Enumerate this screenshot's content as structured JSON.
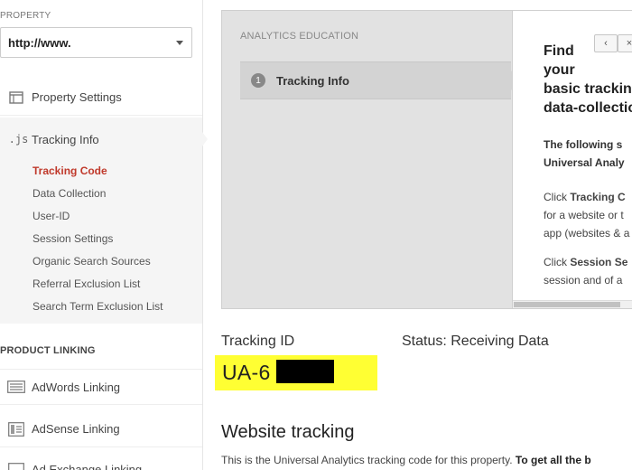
{
  "sidebar": {
    "property_label": "PROPERTY",
    "property_value": "http://www.",
    "items": {
      "property_settings": "Property Settings",
      "tracking_info": "Tracking Info"
    },
    "tracking_subitems": [
      "Tracking Code",
      "Data Collection",
      "User-ID",
      "Session Settings",
      "Organic Search Sources",
      "Referral Exclusion List",
      "Search Term Exclusion List"
    ],
    "js_icon_text": ".js",
    "product_linking_label": "PRODUCT LINKING",
    "linking_items": {
      "adwords": "AdWords Linking",
      "adsense": "AdSense Linking",
      "adexchange": "Ad Exchange Linking"
    }
  },
  "education": {
    "title": "ANALYTICS EDUCATION",
    "step_number": "1",
    "step_label": "Tracking Info",
    "nav_prev": "‹",
    "nav_next": "×",
    "heading": "Find\nyour\nbasic tracking\ndata-collection",
    "p1": "The following s\nUniversal Analy",
    "p2_prefix": "Click ",
    "p2_bold": "Tracking C",
    "p2_rest": "\nfor a website or t\napp (websites & a",
    "p3_prefix": "Click ",
    "p3_bold": "Session Se",
    "p3_rest": "\nsession and of a"
  },
  "tracking": {
    "id_label": "Tracking ID",
    "status": "Status: Receiving Data",
    "id_value": "UA-6         3-5"
  },
  "website_tracking": {
    "heading": "Website tracking",
    "desc_prefix": "This is the Universal Analytics tracking code for this property. ",
    "desc_bold": "To get all the b"
  },
  "colors": {
    "active_link": "#c0392b",
    "highlight": "#ffff33",
    "panel_bg": "#e2e2e2"
  }
}
